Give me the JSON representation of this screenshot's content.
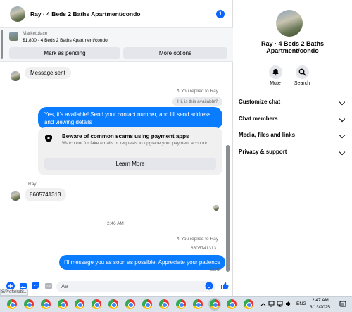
{
  "header": {
    "title": "Ray · 4 Beds 2 Baths Apartment/condo",
    "info_icon": "info-icon"
  },
  "marketplace": {
    "label": "Marketplace",
    "listing": "$1,800 · 4 Beds 2 Baths Apartment/condo",
    "mark_pending": "Mark as pending",
    "more_options": "More options"
  },
  "messages": {
    "message_sent": "Message sent",
    "replied_note_1": "You replied to Ray",
    "quoted_1": "Hi, is this available?",
    "outgoing_1": "Yes, it's available! Send your contact number, and I'll send address and viewing details",
    "scam_title": "Beware of common scams using payment apps",
    "scam_text": "Watch out for fake emails or requests to upgrade your payment account.",
    "learn_more": "Learn More",
    "sender_name": "Ray",
    "incoming_1": "8605741313",
    "timestamp": "2:46 AM",
    "replied_note_2": "You replied to Ray",
    "quoted_2": "8605741313",
    "outgoing_2": "I'll message you as soon as possible. Appreciate your patience",
    "status": "Sent"
  },
  "composer": {
    "placeholder": "Aa"
  },
  "sidebar": {
    "title": "Ray · 4 Beds 2 Baths Apartment/condo",
    "mute": "Mute",
    "search": "Search",
    "sections": [
      "Customize chat",
      "Chat members",
      "Media, files and links",
      "Privacy & support"
    ]
  },
  "status_bar": {
    "url": "S/?referralS..."
  },
  "taskbar": {
    "language": "ENG",
    "time": "2:47 AM",
    "date": "3/13/2025"
  },
  "colors": {
    "accent": "#0866ff",
    "outgoing_bubble": "#0a7cff",
    "incoming_bubble": "#f0f0f0"
  }
}
